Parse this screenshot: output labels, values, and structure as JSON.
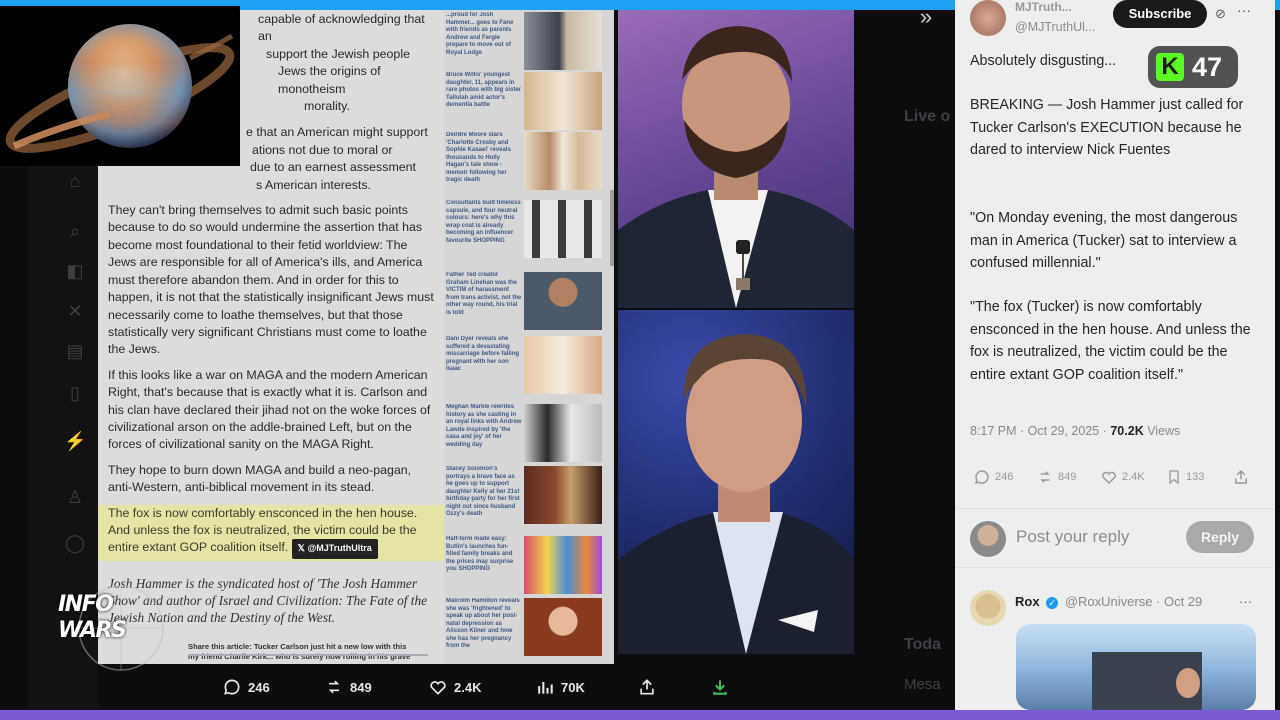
{
  "article": {
    "para0_lines": [
      "capable of acknowledging that an",
      "support the Jewish people",
      "Jews the origins of monotheism",
      "morality."
    ],
    "para1_lines": [
      "e that an American might support",
      "ations not due to moral or",
      "due to an earnest assessment",
      "s American interests."
    ],
    "para2": "They can't bring themselves to admit such basic points because to do so would undermine the assertion that has become most foundational to their fetid worldview: The Jews are responsible for all of America's ills, and America must therefore abandon them. And in order for this to happen, it is not that the statistically insignificant Jews must necessarily come to loathe themselves, but that those statistically very significant Christians must come to loathe the Jews.",
    "para3": "If this looks like a war on MAGA and the modern American Right, that's because that is exactly what it is. Carlson and his clan have declared their jihad not on the woke forces of civilizational arson on the addle-brained Left, but on the forces of civilizational sanity on the MAGA Right.",
    "para4": "They hope to burn down MAGA and build a neo-pagan, anti-Western, anti-biblical movement in its stead.",
    "highlight": "The fox is now comfortably ensconced in the hen house. And unless the fox is neutralized, the victim could be the entire extant GOP coalition itself.",
    "x_tag": "@MJTruthUltra",
    "bio": "Josh Hammer is the syndicated host of 'The Josh Hammer Show' and author of Israel and Civilization: The Fate of the Jewish Nation and the Destiny of the West.",
    "share_line1": "Share this article: Tucker Carlson just hit a new low with this",
    "share_line2": "my friend Charlie Kirk... who is surely now rolling in his grave"
  },
  "news": {
    "items": [
      "...proud for Josh Hammer... goes to Fane with friends as parents Andrew and Fergie prepare to move out of Royal Lodge",
      "Bruce Willis' youngest daughter, 11, appears in rare photos with big sister Tallulah amid actor's dementia battle",
      "Deirdre Moore stars 'Charlotte Crosby and Sophie Kasaei' reveals thousands to Holly Hagan's tale show - memoir following her tragic death",
      "Consultants built timeless capsule, and four neutral colours: here's why this wrap coat is already becoming an influencer favourite SHOPPING",
      "Father Ted creator Graham Linehan was the VICTIM of harassment from trans activist, not the other way round, his trial is told",
      "Dani Dyer reveals she suffered a devastating miscarriage before falling pregnant with her son Isaac",
      "Meghan Markle rewrites history as she casting in an royal links with Andrew Lawde inspired by 'the casa and joy' of her wedding day",
      "Stacey Solomon's portrays a brave face as he goes up to support daughter Kelly at her 21st birthday party for her first night out since husband Ozzy's death",
      "Half-term made easy: Butlin's launches fun-filled family breaks and the prices may surprise you SHOPPING",
      "Malcolm Hamilton reveals she was 'frightened' to speak up about her post-natal depression as Alisson Kliner and how she has her pregnancy from the"
    ]
  },
  "tweet": {
    "handle": "@MJTruthUl...",
    "name": "MJTruth...",
    "subscribe": "Subscribe",
    "intro": "Absolutely disgusting...",
    "badge": "47",
    "body1": "BREAKING — Josh Hammer just called for Tucker Carlson's EXECUTION because he dared to interview Nick Fuentes",
    "body2": "\"On Monday evening, the most dangerous man in America (Tucker) sat to interview a confused millennial.\"",
    "body3": "\"The fox (Tucker) is now comfortably ensconced in the hen house. And unless the fox is neutralized, the victim could be the entire extant GOP coalition itself.\"",
    "time": "8:17 PM · Oct 29, 2025 · ",
    "views_count": "70.2K",
    "views_label": " Views",
    "stats": {
      "replies": "246",
      "reposts": "849",
      "likes": "2.4K",
      "bookmarks": "133"
    },
    "reply_placeholder": "Post your reply",
    "reply_button": "Reply",
    "reply_author": "Rox",
    "reply_handle": "@RoxUniverse · Oct 29"
  },
  "bottom_stats": {
    "replies": "246",
    "reposts": "849",
    "likes": "2.4K",
    "views": "70K"
  },
  "logo_text": "INFO WARS",
  "colors": {
    "accent_top": "#1da1f2",
    "accent_bottom": "#7c5cd6",
    "verified": "#1d9bf0",
    "badge_green": "#53fc18"
  }
}
